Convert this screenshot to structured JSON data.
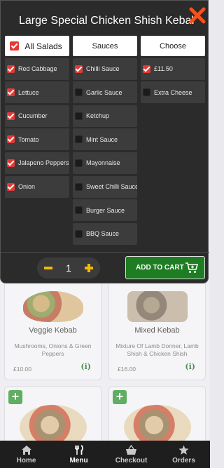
{
  "modal": {
    "title": "Large Special Chicken Shish Kebab",
    "columns": [
      {
        "header": "All Salads",
        "header_checked": true,
        "options": [
          {
            "label": "Red Cabbage",
            "checked": true
          },
          {
            "label": "Lettuce",
            "checked": true
          },
          {
            "label": "Cucumber",
            "checked": true
          },
          {
            "label": "Tomato",
            "checked": true
          },
          {
            "label": "Jalapeno Peppers",
            "checked": true
          },
          {
            "label": "Onion",
            "checked": true
          }
        ]
      },
      {
        "header": "Sauces",
        "options": [
          {
            "label": "Chilli Sauce",
            "checked": true
          },
          {
            "label": "Garlic Sauce",
            "checked": false
          },
          {
            "label": "Ketchup",
            "checked": false
          },
          {
            "label": "Mint Sauce",
            "checked": false
          },
          {
            "label": "Mayonnaise",
            "checked": false
          },
          {
            "label": "Sweet Chilli Sauce",
            "checked": false
          },
          {
            "label": "Burger Sauce",
            "checked": false
          },
          {
            "label": "BBQ Sauce",
            "checked": false
          }
        ]
      },
      {
        "header": "Choose",
        "options": [
          {
            "label": "£11.50",
            "checked": true
          },
          {
            "label": "Extra Cheese",
            "checked": false
          }
        ]
      }
    ],
    "quantity": "1",
    "add_to_cart_label": "ADD TO CART"
  },
  "menu_cards": [
    {
      "name": "Veggie Kebab",
      "description": "Mushrooms, Onions & Green Peppers",
      "price": "£10.00",
      "info": "(i)"
    },
    {
      "name": "Mixed Kebab",
      "description": "Mixture Of Lamb Donner, Lamb Shish & Chicken Shish",
      "price": "£16.00",
      "info": "(i)"
    }
  ],
  "bottom_nav": [
    {
      "label": "Home",
      "icon": "home-icon",
      "active": false
    },
    {
      "label": "Menu",
      "icon": "cutlery-icon",
      "active": true
    },
    {
      "label": "Checkout",
      "icon": "basket-icon",
      "active": false
    },
    {
      "label": "Orders",
      "icon": "star-icon",
      "active": false
    }
  ],
  "colors": {
    "accent_red": "#e53935",
    "cart_green": "#1e7d22",
    "qty_yellow": "#f5b800",
    "close_orange": "#f4511e"
  }
}
